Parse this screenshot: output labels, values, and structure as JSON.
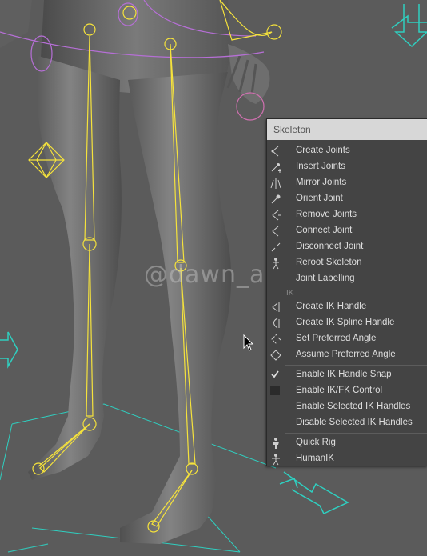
{
  "watermark": "@dawn_arc",
  "menu": {
    "title": "Skeleton",
    "items": [
      {
        "label": "Create Joints",
        "icon": "create-joints-icon"
      },
      {
        "label": "Insert Joints",
        "icon": "insert-joints-icon"
      },
      {
        "label": "Mirror Joints",
        "icon": "mirror-joints-icon"
      },
      {
        "label": "Orient Joint",
        "icon": "orient-joint-icon"
      },
      {
        "label": "Remove Joints",
        "icon": "remove-joints-icon"
      },
      {
        "label": "Connect Joint",
        "icon": "connect-joint-icon"
      },
      {
        "label": "Disconnect Joint",
        "icon": "disconnect-joint-icon"
      },
      {
        "label": "Reroot Skeleton",
        "icon": "reroot-skeleton-icon"
      },
      {
        "label": "Joint Labelling",
        "icon": ""
      }
    ],
    "ik_section": "IK",
    "ik_items": [
      {
        "label": "Create IK Handle",
        "icon": "ik-handle-icon"
      },
      {
        "label": "Create IK Spline Handle",
        "icon": "ik-spline-handle-icon"
      },
      {
        "label": "Set Preferred Angle",
        "icon": "set-preferred-angle-icon"
      },
      {
        "label": "Assume Preferred Angle",
        "icon": "assume-preferred-angle-icon"
      }
    ],
    "toggle_items": [
      {
        "label": "Enable IK Handle Snap",
        "checked": true
      },
      {
        "label": "Enable IK/FK Control",
        "checked": false
      },
      {
        "label": "Enable Selected IK Handles"
      },
      {
        "label": "Disable Selected IK Handles"
      }
    ],
    "rig_items": [
      {
        "label": "Quick Rig",
        "icon": "quick-rig-icon"
      },
      {
        "label": "HumanIK",
        "icon": "humanik-icon"
      }
    ]
  },
  "colors": {
    "viewport_bg": "#5b5b5b",
    "joint": "#f5e23c",
    "curve": "#b66fd6",
    "manipulator": "#2fcfc0",
    "menu_bg": "#444444",
    "menu_title_bg": "#d7d7d7"
  }
}
